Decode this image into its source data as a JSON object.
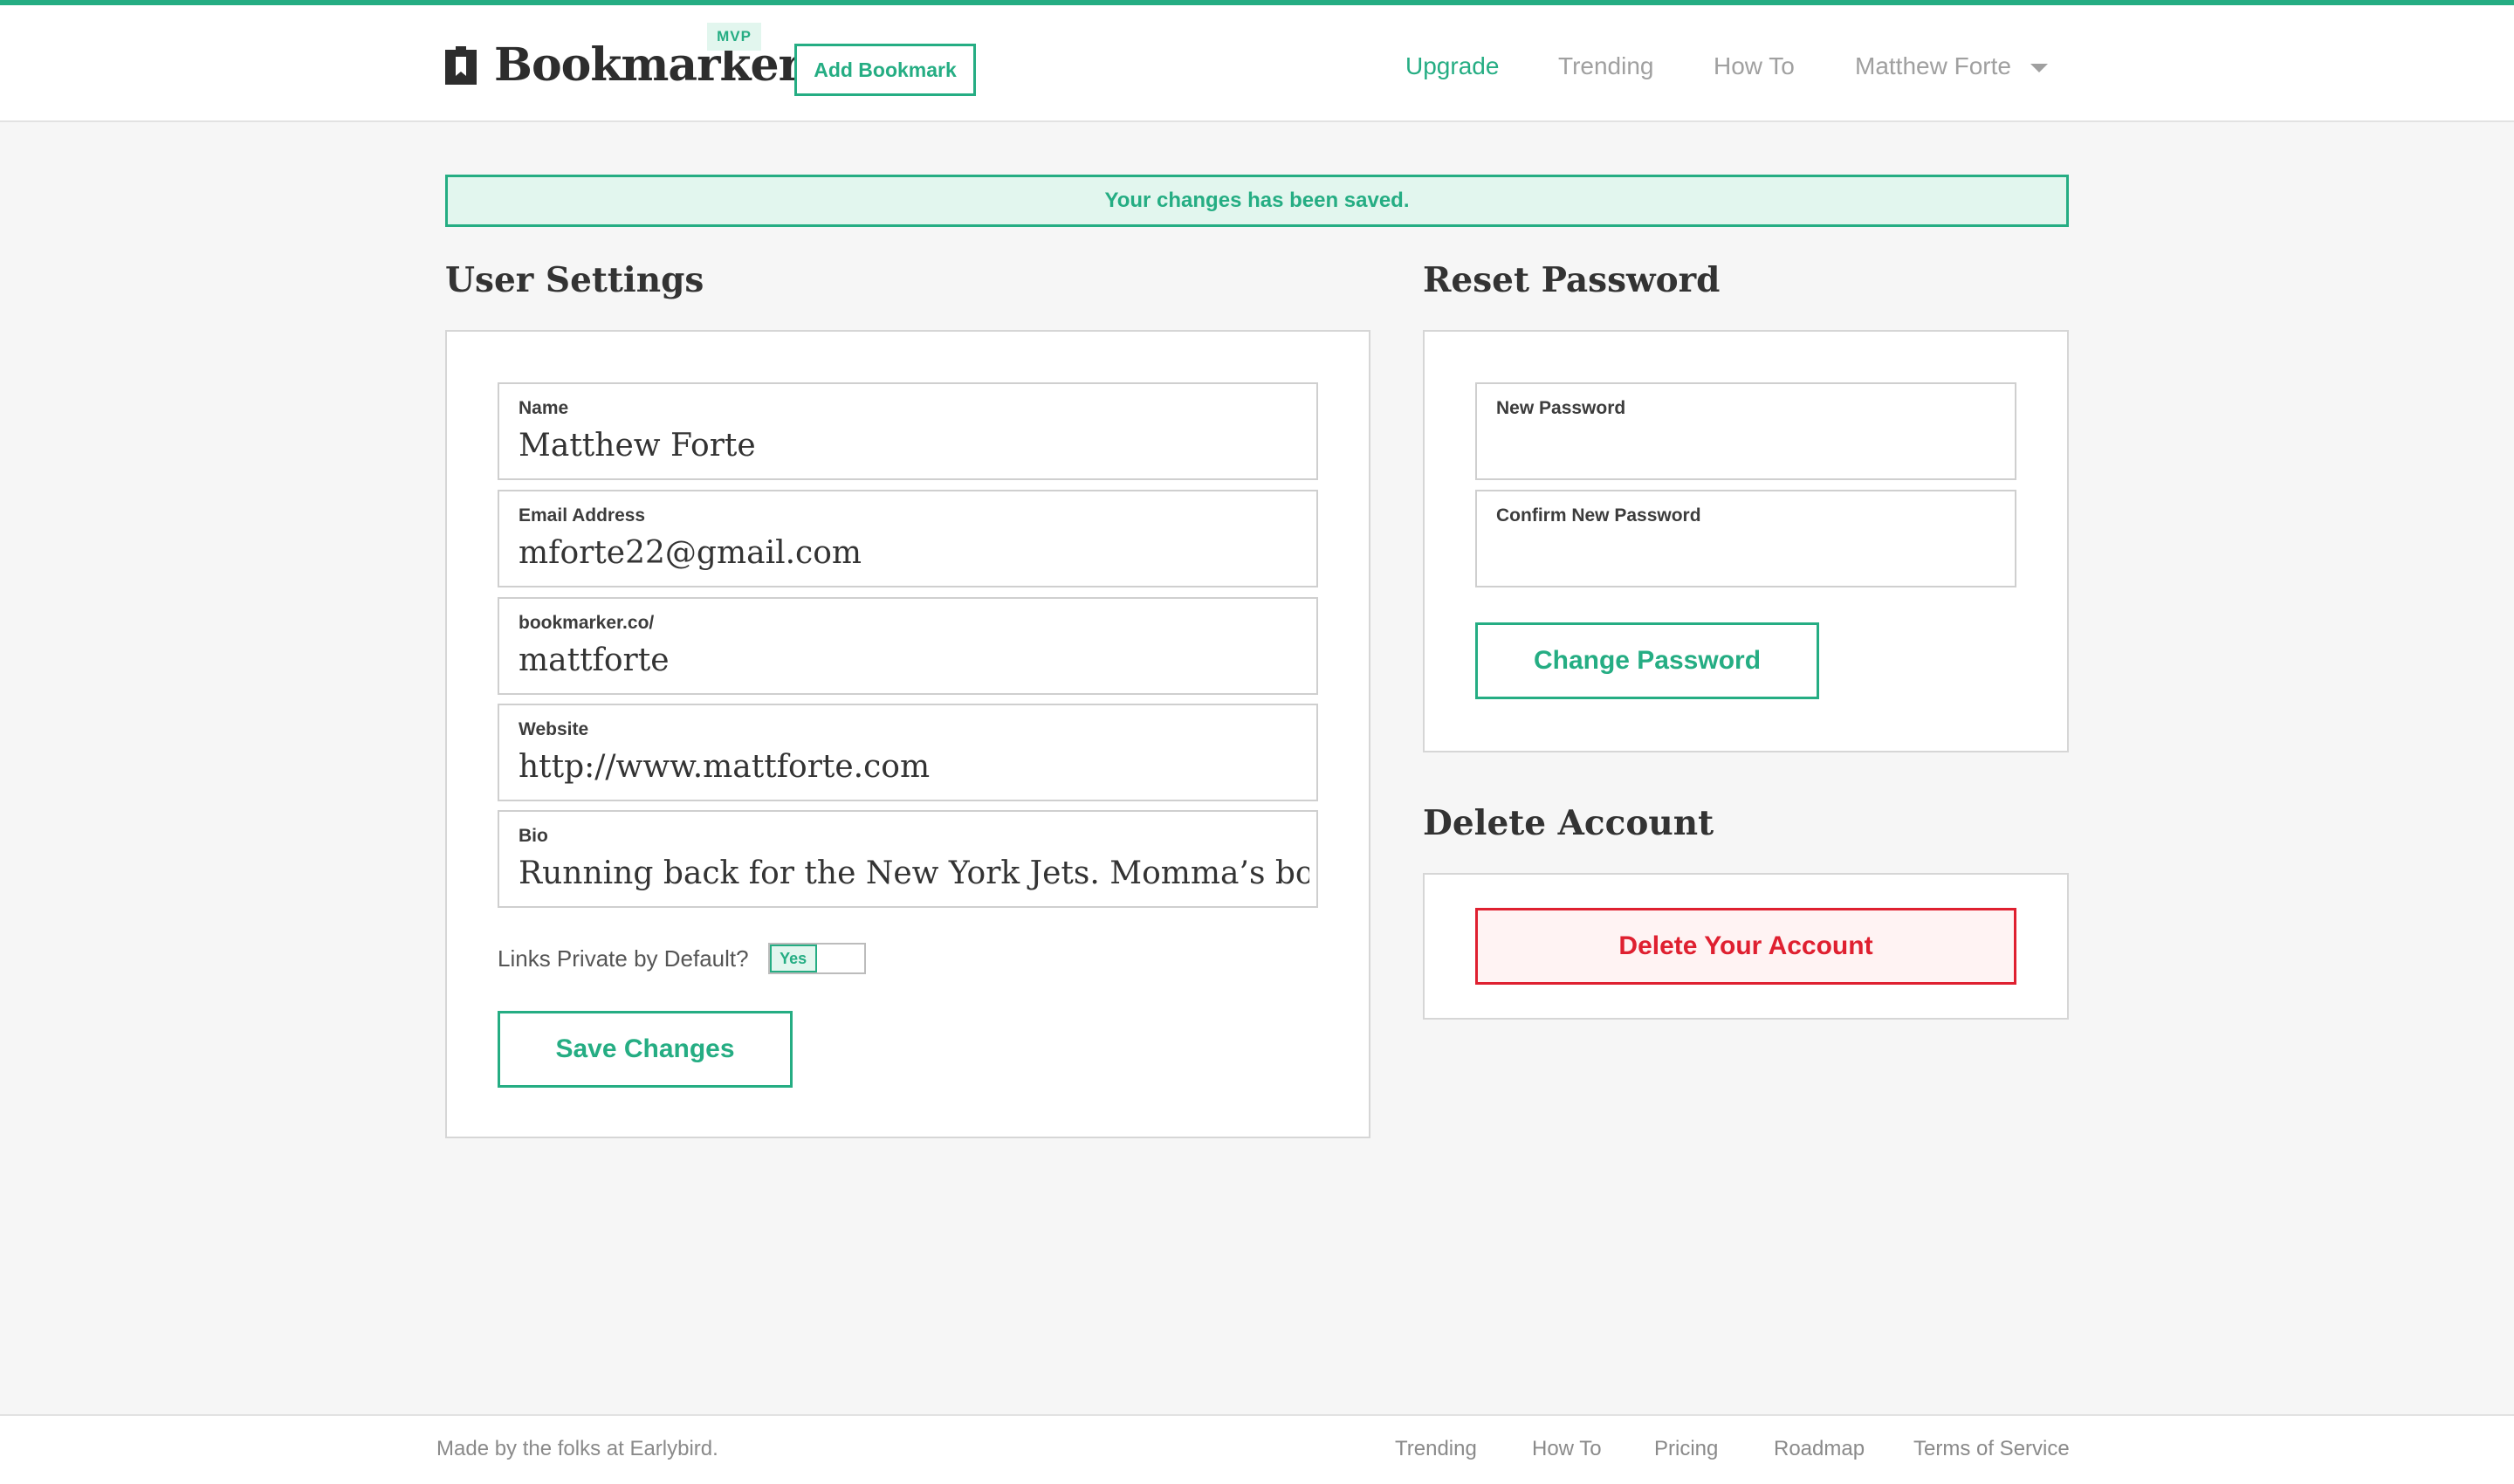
{
  "colors": {
    "accent": "#25ad83",
    "accent_light": "#e2f6ee",
    "danger": "#df2030",
    "danger_light": "#fff3f3"
  },
  "header": {
    "logo_icon": "bookmark-logo-icon",
    "logo_text": "Bookmarker",
    "badge": "MVP",
    "add_bookmark": "Add Bookmark",
    "nav": {
      "upgrade": "Upgrade",
      "trending": "Trending",
      "howto": "How To",
      "user": "Matthew Forte"
    }
  },
  "banner": {
    "message": "Your changes has been saved."
  },
  "user_settings": {
    "title": "User Settings",
    "fields": {
      "name": {
        "label": "Name",
        "value": "Matthew Forte"
      },
      "email": {
        "label": "Email Address",
        "value": "mforte22@gmail.com"
      },
      "username": {
        "label": "bookmarker.co/",
        "value": "mattforte"
      },
      "website": {
        "label": "Website",
        "value": "http://www.mattforte.com"
      },
      "bio": {
        "label": "Bio",
        "value": "Running back for the New York Jets. Momma’s boy. N"
      }
    },
    "private_toggle": {
      "label": "Links Private by Default?",
      "state": "Yes"
    },
    "save": "Save Changes"
  },
  "reset_password": {
    "title": "Reset Password",
    "new_label": "New Password",
    "confirm_label": "Confirm New Password",
    "button": "Change Password"
  },
  "delete_account": {
    "title": "Delete Account",
    "button": "Delete Your Account"
  },
  "footer": {
    "credit": "Made by the folks at Earlybird.",
    "links": {
      "trending": "Trending",
      "howto": "How To",
      "pricing": "Pricing",
      "roadmap": "Roadmap",
      "terms": "Terms of Service"
    }
  }
}
